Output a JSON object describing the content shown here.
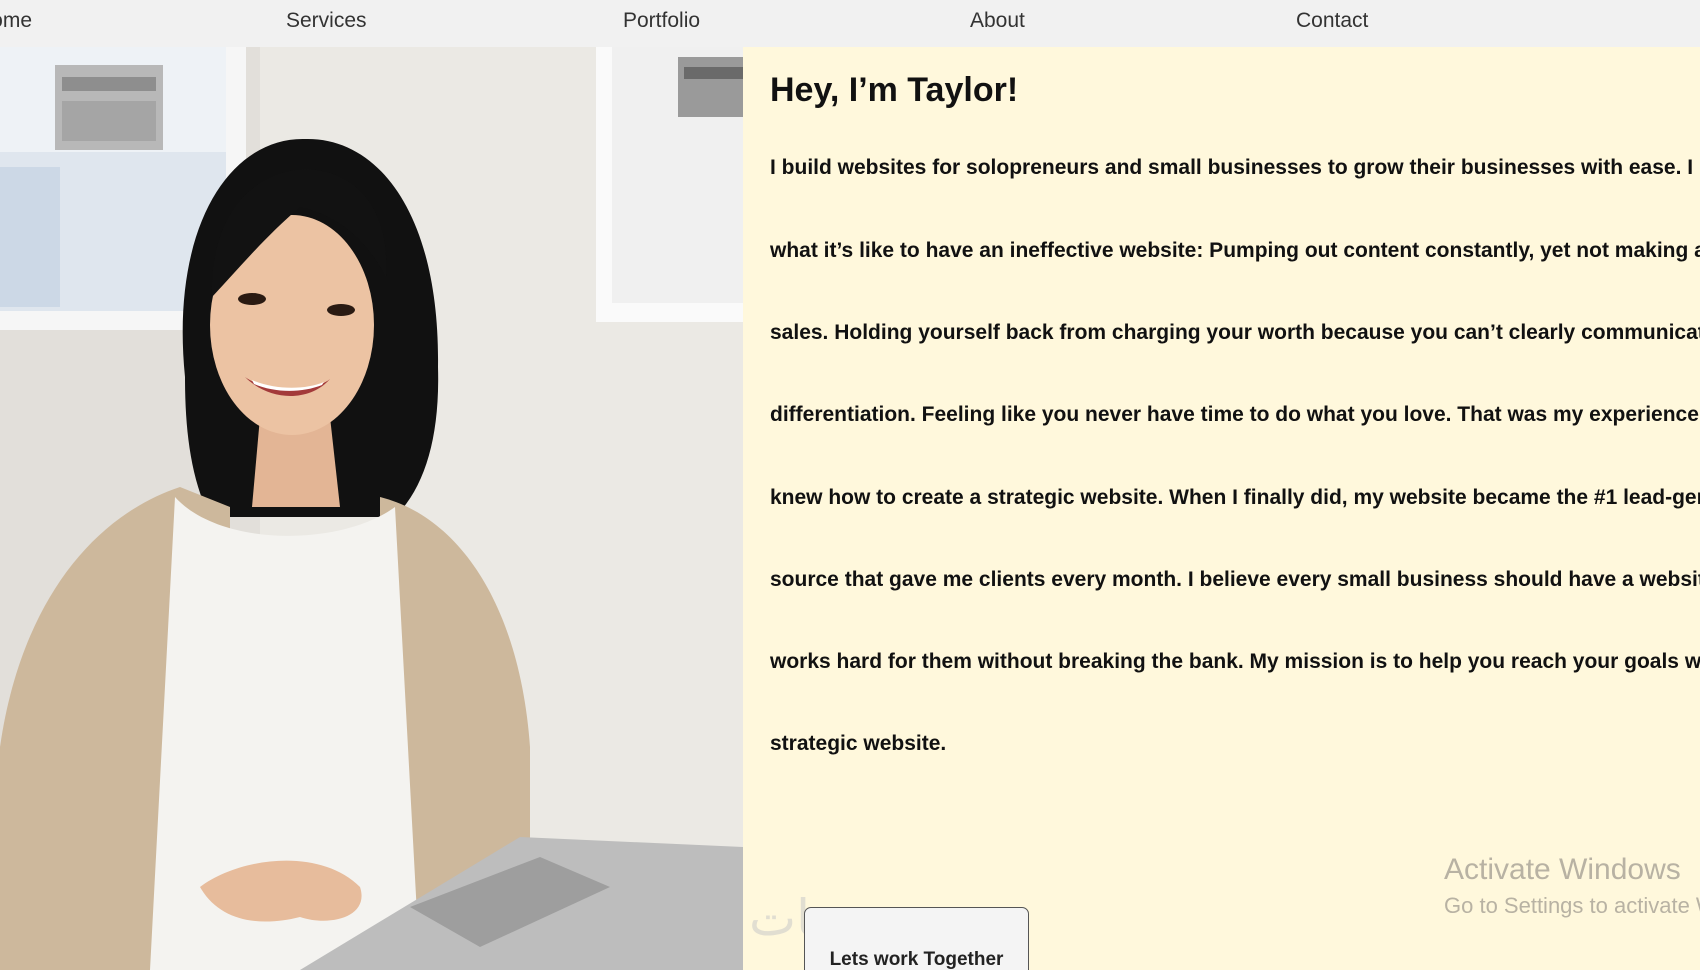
{
  "nav": {
    "items": [
      {
        "label": "Home"
      },
      {
        "label": "Services"
      },
      {
        "label": "Portfolio"
      },
      {
        "label": "About"
      },
      {
        "label": "Contact"
      }
    ]
  },
  "about": {
    "heading": "Hey, I’m Taylor!",
    "bio_lines": [
      "I build websites for solopreneurs and small businesses to grow their businesses with ease. I know",
      "what it’s like to have an ineffective website: Pumping out content constantly, yet not making any",
      "sales. Holding yourself back from charging your worth because you can’t clearly communicate your",
      "differentiation. Feeling like you never have time to do what you love. That was my experience until I",
      "knew how to create a strategic website. When I finally did, my website became the #1 lead-generating",
      "source that gave me clients every month. I believe every small business should have a website that",
      "works hard for them without breaking the bank. My mission is to help you reach your goals with a",
      "strategic website."
    ],
    "cta_label": "Lets work Together"
  },
  "overlay": {
    "watermark_text": "خمسات",
    "activate_title": "Activate Windows",
    "activate_subtitle": "Go to Settings to activate Windows."
  },
  "colors": {
    "nav_bg": "#f1f1f1",
    "content_bg": "#fff8dc",
    "text": "#111111"
  }
}
